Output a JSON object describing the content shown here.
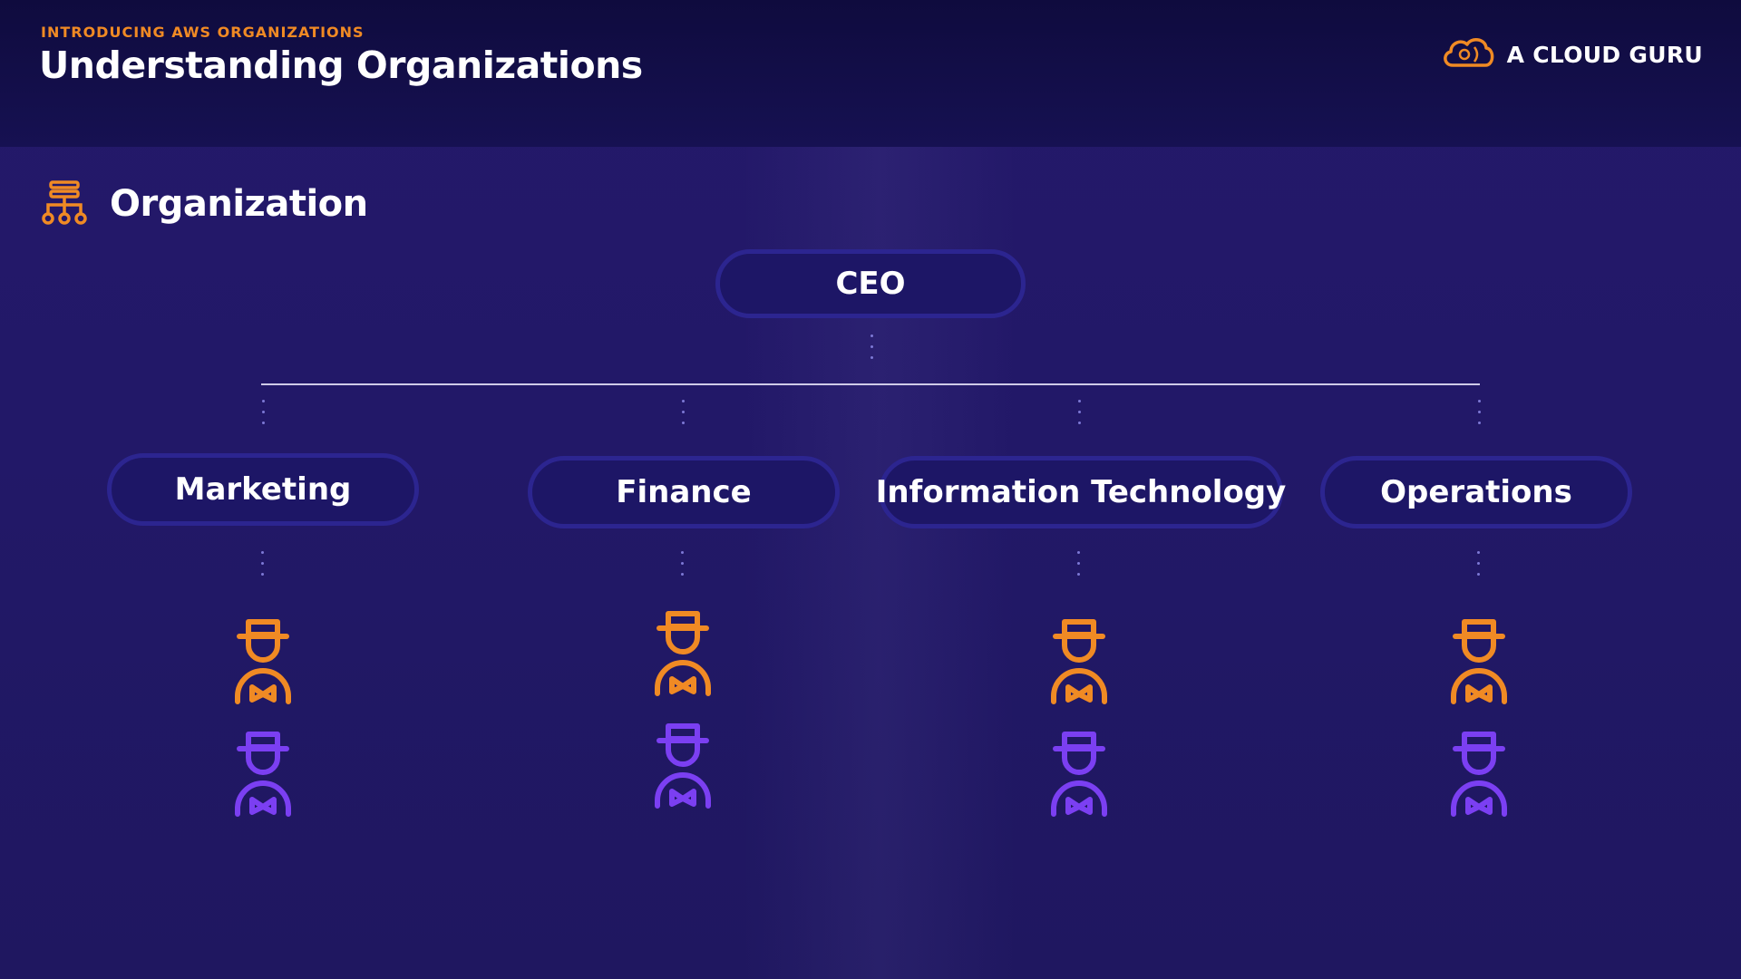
{
  "header": {
    "eyebrow": "INTRODUCING AWS ORGANIZATIONS",
    "title": "Understanding Organizations",
    "brand": "A CLOUD GURU",
    "brand_icon": "cloud-icon"
  },
  "section": {
    "title": "Organization",
    "icon": "org-chart-icon"
  },
  "org_chart": {
    "root": "CEO",
    "departments": [
      {
        "label": "Marketing",
        "member_icons": [
          "person-icon",
          "person-icon"
        ]
      },
      {
        "label": "Finance",
        "member_icons": [
          "person-icon",
          "person-icon"
        ]
      },
      {
        "label": "Information Technology",
        "member_icons": [
          "person-icon",
          "person-icon"
        ]
      },
      {
        "label": "Operations",
        "member_icons": [
          "person-icon",
          "person-icon"
        ]
      }
    ]
  },
  "colors": {
    "accent_orange": "#f08a24",
    "accent_purple": "#7b3ff2",
    "node_border": "#2c2590",
    "background": "#221868"
  }
}
